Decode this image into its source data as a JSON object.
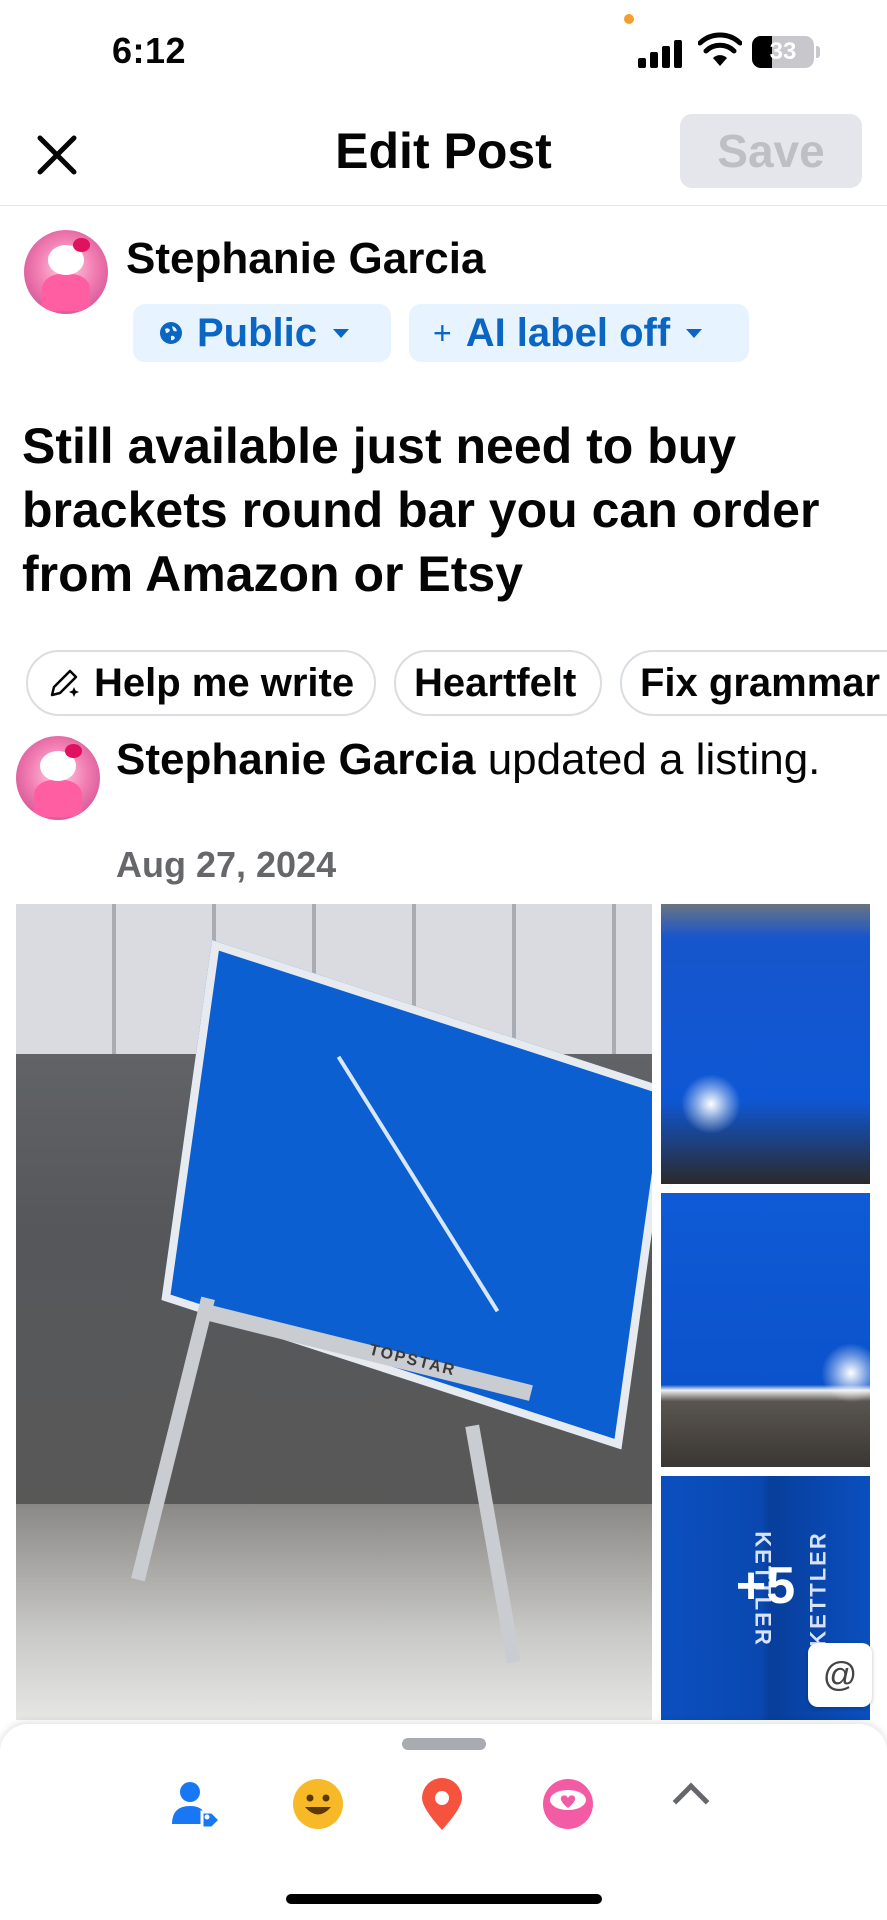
{
  "status_bar": {
    "time": "6:12",
    "battery": "33",
    "battery_level": 0.33
  },
  "header": {
    "title": "Edit Post",
    "save_label": "Save"
  },
  "author": {
    "name": "Stephanie Garcia"
  },
  "audience": {
    "label": "Public",
    "icon": "globe-icon"
  },
  "ai_label": {
    "label": "AI label off",
    "icon": "plus-icon"
  },
  "post": {
    "text": "Still available just need to buy brackets round bar you can order from Amazon or Etsy"
  },
  "ai_chips": [
    {
      "label": "Help me write",
      "icon": "pencil-sparkle-icon"
    },
    {
      "label": "Heartfelt"
    },
    {
      "label": "Fix grammar"
    }
  ],
  "shared": {
    "author": "Stephanie Garcia",
    "action": " updated a listing.",
    "date": "Aug 27, 2024",
    "more_photos": "+5",
    "mention_symbol": "@",
    "brand_text": "KETTLER",
    "table_text": "TOPSTAR"
  },
  "toolbar": {
    "items": [
      "tag-people-icon",
      "feeling-emoji-icon",
      "location-pin-icon",
      "sticker-icon",
      "expand-chevron-icon"
    ]
  },
  "colors": {
    "accent": "#0a66c2",
    "accent_bg": "#e7f3ff",
    "save_disabled_bg": "#e4e6eb",
    "secondary_text": "#65676b"
  }
}
